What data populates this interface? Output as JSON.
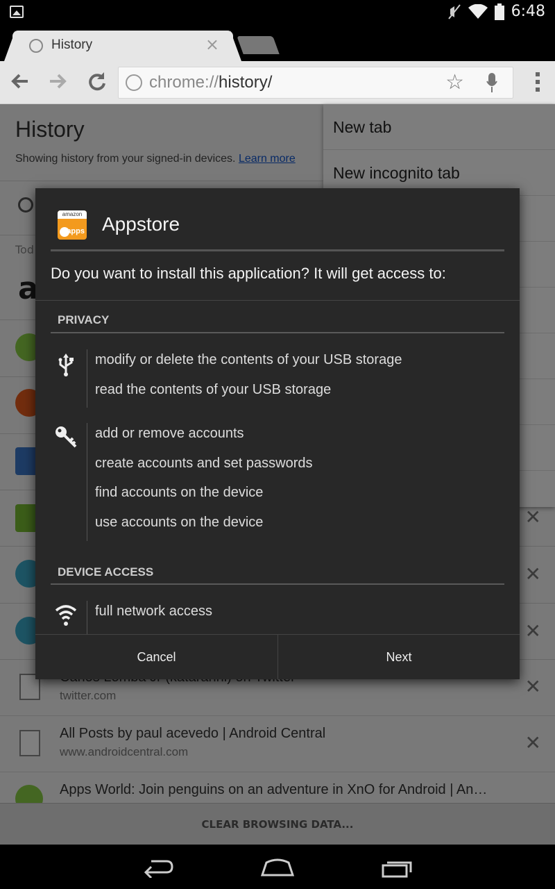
{
  "status_bar": {
    "time": "6:48",
    "icons": [
      "image-notification-icon",
      "mute-icon",
      "wifi-icon",
      "battery-icon"
    ]
  },
  "tab": {
    "title": "History",
    "close": "×"
  },
  "toolbar": {
    "url_scheme": "chrome://",
    "url_path": "history/"
  },
  "history_page": {
    "title": "History",
    "subtitle": "Showing history from your signed-in devices.",
    "learn_more": "Learn more",
    "section_label": "Tod",
    "rows": [
      {
        "title": "Carlos Lomba Jr (kataranhi) on Twitter",
        "url": "twitter.com",
        "favicon": "doc"
      },
      {
        "title": "All Posts by paul acevedo | Android Central",
        "url": "www.androidcentral.com",
        "favicon": "doc"
      },
      {
        "title": "Apps World: Join penguins on an adventure in XnO for Android | An…",
        "url": "",
        "favicon": "android"
      }
    ],
    "clear_button": "CLEAR BROWSING DATA..."
  },
  "overflow_menu": {
    "items": [
      "New tab",
      "New incognito tab"
    ]
  },
  "dialog": {
    "app_name": "Appstore",
    "icon_top": "amazon",
    "icon_label": "apps",
    "question": "Do you want to install this application? It will get access to:",
    "sections": [
      {
        "title": "PRIVACY",
        "groups": [
          {
            "icon": "usb-icon",
            "permissions": [
              "modify or delete the contents of your USB storage",
              "read the contents of your USB storage"
            ]
          },
          {
            "icon": "key-icon",
            "permissions": [
              "add or remove accounts",
              "create accounts and set passwords",
              "find accounts on the device",
              "use accounts on the device"
            ]
          }
        ]
      },
      {
        "title": "DEVICE ACCESS",
        "groups": [
          {
            "icon": "wifi-icon",
            "permissions": [
              "full network access"
            ]
          }
        ]
      }
    ],
    "cancel": "Cancel",
    "next": "Next"
  },
  "colors": {
    "dialog_bg": "#282828",
    "appstore_orange": "#f39a1e",
    "link": "#1155cc"
  }
}
